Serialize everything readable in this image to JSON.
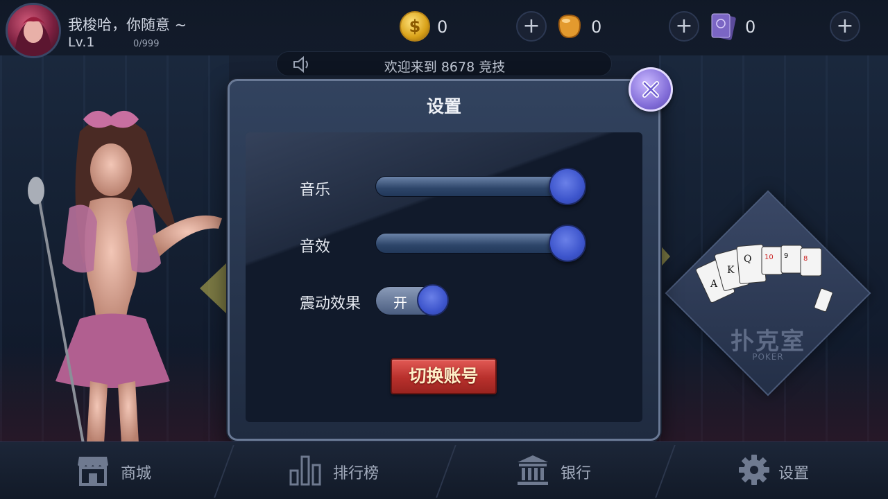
{
  "player": {
    "name": "我梭哈，你随意 ~",
    "level": "Lv.1",
    "exp": "0/999"
  },
  "currencies": [
    {
      "icon": "gold-coin-icon",
      "value": "0"
    },
    {
      "icon": "bean-icon",
      "value": "0"
    },
    {
      "icon": "room-card-icon",
      "value": "0"
    }
  ],
  "marquee": {
    "text": "欢迎来到 8678 竞技"
  },
  "settings": {
    "title": "设置",
    "music_label": "音乐",
    "music_level": 1.0,
    "sfx_label": "音效",
    "sfx_level": 1.0,
    "vibration_label": "震动效果",
    "vibration_state": "开",
    "switch_account_label": "切换账号"
  },
  "poker_room": {
    "title": "扑克室",
    "subtitle": "POKER"
  },
  "bottom_nav": [
    {
      "label": "商城",
      "icon": "shop-icon"
    },
    {
      "label": "排行榜",
      "icon": "ranking-icon"
    },
    {
      "label": "银行",
      "icon": "bank-icon"
    },
    {
      "label": "设置",
      "icon": "gear-icon"
    }
  ],
  "colors": {
    "accent_blue": "#3d55cc",
    "button_red": "#c4342f",
    "close_purple": "#7f6ad6"
  }
}
